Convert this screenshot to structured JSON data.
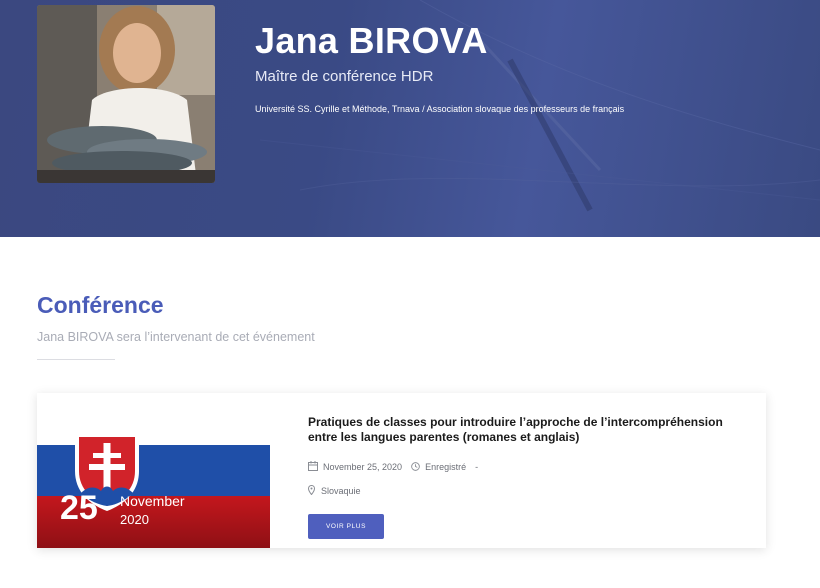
{
  "speaker": {
    "name": "Jana BIROVA",
    "title": "Maître de conférence HDR",
    "organization": "Université SS. Cyrille et Méthode, Trnava / Association slovaque des professeurs de français"
  },
  "section": {
    "title": "Conférence",
    "subtitle": "Jana BIROVA sera l’intervenant de cet événement"
  },
  "event": {
    "title": "Pratiques de classes pour introduire l’approche de l’intercompréhension entre les langues parentes (romanes et anglais)",
    "date_day": "25",
    "date_month": "November",
    "date_year": "2020",
    "date_text": "November 25, 2020",
    "status": "Enregistré",
    "status_suffix": "-",
    "location": "Slovaquie",
    "button_label": "VOIR PLUS",
    "icons": {
      "date": "calendar-icon",
      "status": "clock-icon",
      "location": "map-pin-icon"
    }
  },
  "colors": {
    "hero_background": "#3b4880",
    "accent": "#4a5cb8",
    "button": "#4f5fbe",
    "flag_white": "#ffffff",
    "flag_blue": "#1f4fa8",
    "flag_red": "#c4171d"
  }
}
